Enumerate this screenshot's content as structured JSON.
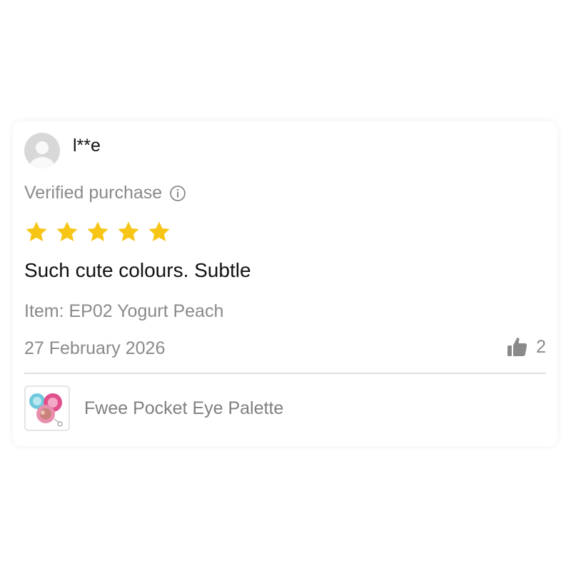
{
  "review": {
    "username": "l**e",
    "verified_label": "Verified purchase",
    "rating": 5,
    "rating_max": 5,
    "text": "Such cute colours. Subtle",
    "item": "Item: EP02 Yogurt Peach",
    "date": "27 February 2026",
    "likes": "2"
  },
  "product": {
    "name": "Fwee Pocket Eye Palette"
  },
  "icons": {
    "avatar": "user-avatar-placeholder",
    "info": "info-icon",
    "star": "star-icon",
    "like": "thumbs-up-icon"
  },
  "colors": {
    "star": "#F7C515",
    "muted_text": "#8A8A8A",
    "avatar_bg": "#D8D8D8"
  }
}
